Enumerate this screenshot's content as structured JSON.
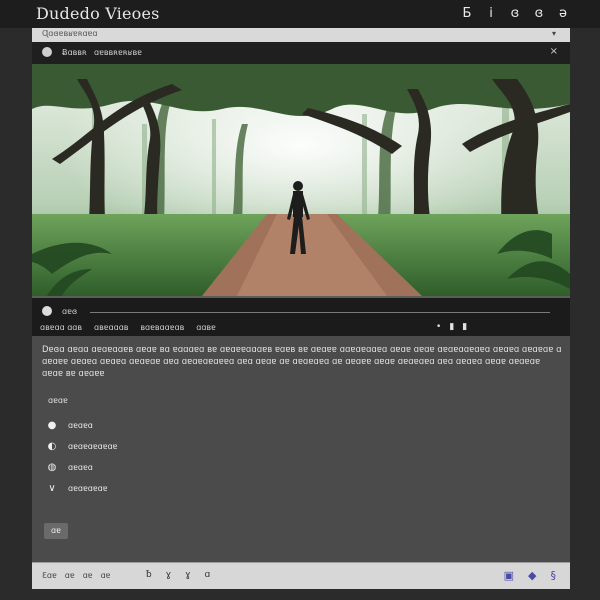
{
  "app": {
    "title": "Dudedo Vieoes",
    "top_icons": [
      "Ƃ",
      "i",
      "ɞ",
      "ɞ",
      "ǝ"
    ]
  },
  "address": {
    "text": "Ɋɑɞɐʙʁɐʀɑɐɑ",
    "dropdown": "▾"
  },
  "header": {
    "label": "Ƀɑʙʙʀ",
    "label2": "ɑɐʙʙʀɐʀʁʙɐ",
    "close": "×"
  },
  "controls": {
    "progress_label": "ɑɐɞ",
    "meta": [
      "ɑʙɐɑɑ ɑɑʙ",
      "ɑʙɐɑɑɑʙ",
      "ʙɑɐʙɑɑɐɑʙ",
      "ɑɑʙɐ"
    ],
    "mini": [
      "•",
      "▮",
      "▮"
    ]
  },
  "content": {
    "description": "Dɐɞɑ ɑɐɑɑ ɑɐɑɐɑɑɐʙ ɑɐɑɐ ʙɑ ɐɑɑɑɐɑ ʙɐ ɑɐɑɐɐɑɑɑɐʙ ɐɑɐʙ ʙɐ ɑɐɑɐɐ ɑɑɐɑɐɑɑɐɑ ɑɐɑɐ ɑɐɑɐ ɑɐɑɐɑɑɐɑɐɑ ɑɐɑɐɑ ɑɐɑɐɑɐ ɑ ɑɐɑɐɐ ɑɐɑɐɑ ɑɐɑɐɑ ɑɐɑɐɑɐ ɑɐɑ ɑɐɑɐɑɐɑɐɐɑ ɑɐɑ ɑɐɑɐ ɑɐ ɑɐɑɐɑɐɑ ɑɐ ɑɐɑɐɐ ɑɐɑɐ ɑɐɑɐɑɐɑ ɑɐɑ ɑɐɑɐɑ ɑɐɑɐ ɑɐɑɐɑɐ ɑɐɑɐ ʙɐ ɑɐɑɐɐ",
    "list_label": "ɑɐɑɐ",
    "options": [
      {
        "mark": "●",
        "label": "ɑɐɑɐɑ"
      },
      {
        "mark": "◐",
        "label": "ɑɐɑɐɑɐɑɐɑɐ"
      },
      {
        "mark": "◍",
        "label": "ɑɐɑɐɑ"
      },
      {
        "mark": "∨",
        "label": "ɑɐɑɐɑɐɑɐ"
      }
    ],
    "button_label": "ɑɐ"
  },
  "bottombar": {
    "left": [
      "Ɛɑɐ",
      "ɑɐ",
      "ɑɐ",
      "ɑɐ"
    ],
    "mid": [
      "ƀ",
      "ɣ",
      "ɣ",
      "ɑ"
    ],
    "right": [
      "▣",
      "◆",
      "§"
    ]
  },
  "colors": {
    "bg": "#2b2b2b",
    "panel": "#4b4b4b",
    "bar": "#d7d7d7",
    "accent": "#4a4aa8"
  }
}
